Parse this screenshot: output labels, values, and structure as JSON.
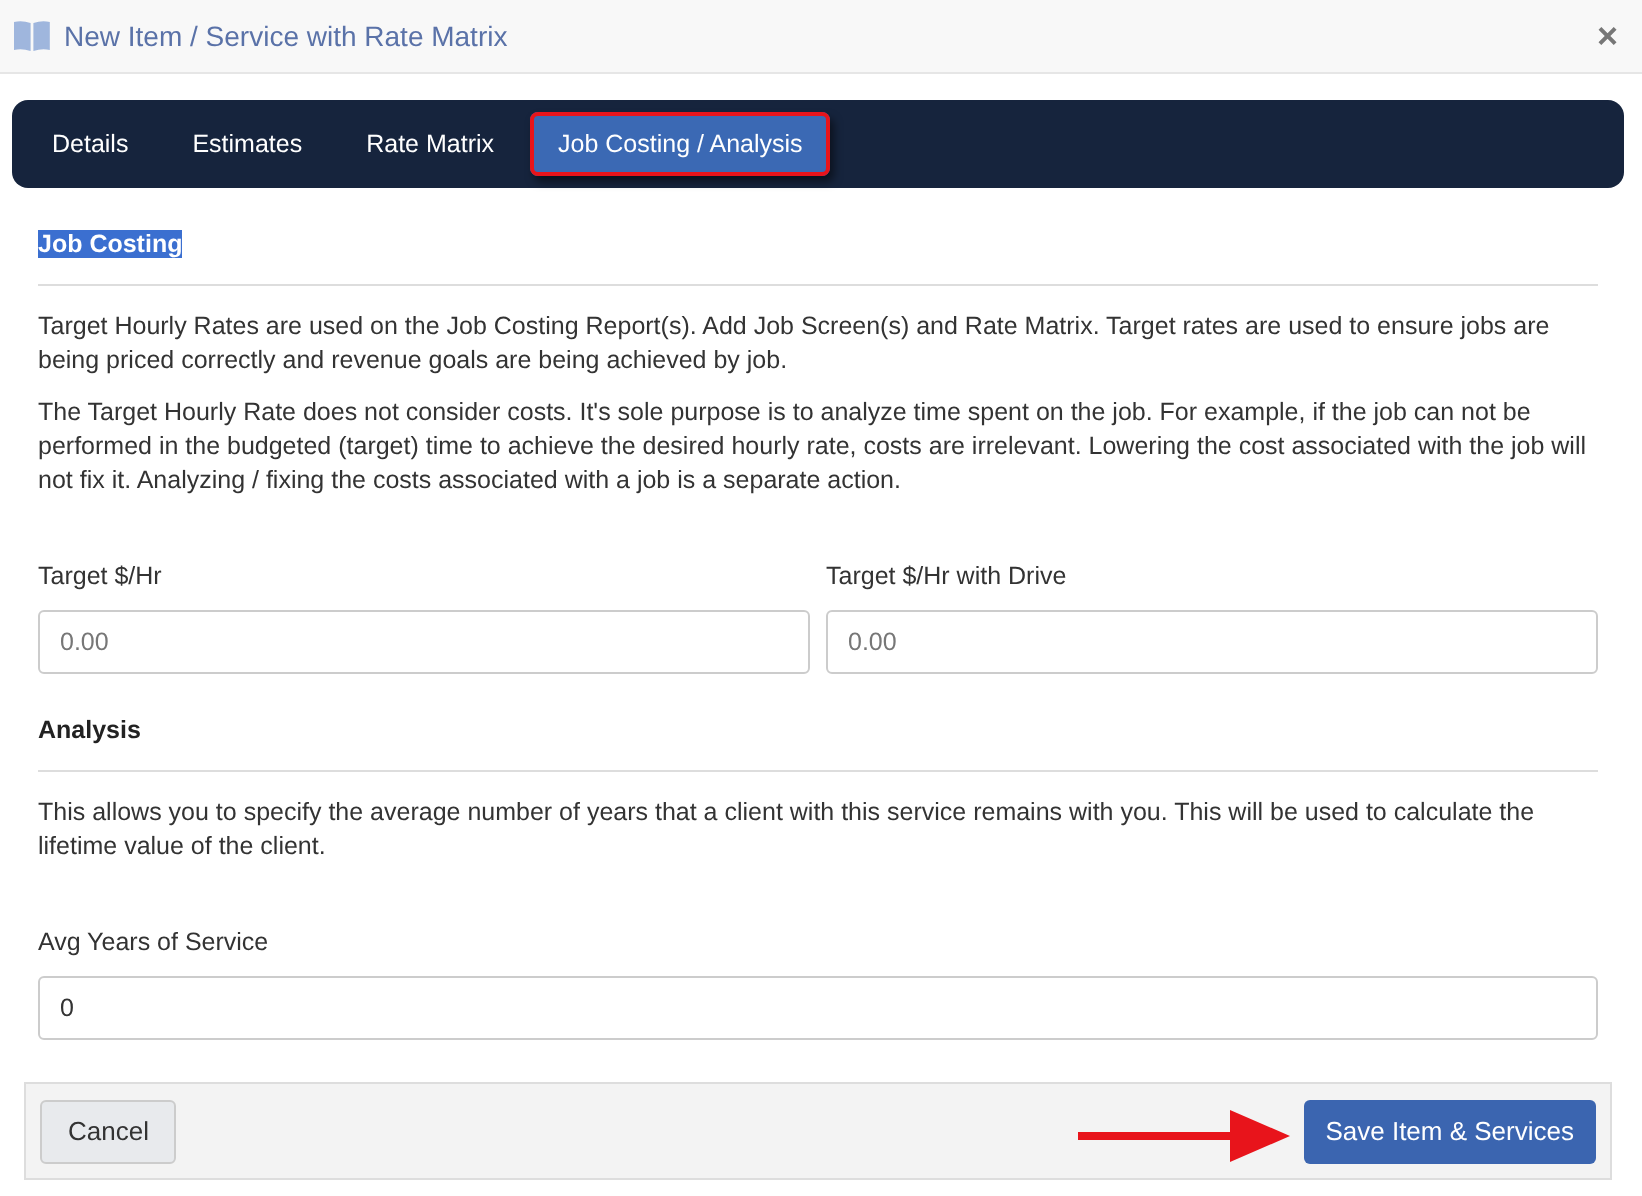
{
  "window": {
    "title": "New Item / Service with Rate Matrix",
    "close": "×"
  },
  "tabs": [
    {
      "label": "Details",
      "selected": false,
      "outlined": false
    },
    {
      "label": "Estimates",
      "selected": false,
      "outlined": false
    },
    {
      "label": "Rate Matrix",
      "selected": false,
      "outlined": false
    },
    {
      "label": "Job Costing / Analysis",
      "selected": true,
      "outlined": true
    }
  ],
  "job_costing": {
    "heading": "Job Costing",
    "heading_highlighted": true,
    "paragraphs": [
      "Target Hourly Rates are used on the Job Costing Report(s). Add Job Screen(s) and Rate Matrix. Target rates are used to ensure jobs are being priced correctly and revenue goals are being achieved by job.",
      "The Target Hourly Rate does not consider costs. It's sole purpose is to analyze time spent on the job. For example, if the job can not be performed in the budgeted (target) time to achieve the desired hourly rate, costs are irrelevant. Lowering the cost associated with the job will not fix it. Analyzing / fixing the costs associated with a job is a separate action."
    ],
    "fields": [
      {
        "label": "Target $/Hr",
        "placeholder": "0.00"
      },
      {
        "label": "Target $/Hr with Drive",
        "placeholder": "0.00"
      }
    ]
  },
  "analysis": {
    "heading": "Analysis",
    "paragraph": "This allows you to specify the average number of years that a client with this service remains with you. This will be used to calculate the lifetime value of the client.",
    "field": {
      "label": "Avg Years of Service",
      "value": "0"
    }
  },
  "footer": {
    "cancel": "Cancel",
    "save": "Save Item & Services",
    "save_arrow": true
  }
}
